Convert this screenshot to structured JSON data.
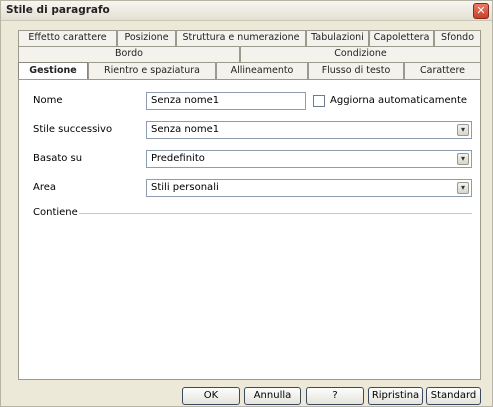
{
  "window": {
    "title": "Stile di paragrafo"
  },
  "tabs": {
    "row1": [
      "Effetto carattere",
      "Posizione",
      "Struttura e numerazione",
      "Tabulazioni",
      "Capolettera",
      "Sfondo"
    ],
    "row2": [
      "Bordo",
      "Condizione"
    ],
    "row3": [
      "Gestione",
      "Rientro e spaziatura",
      "Allineamento",
      "Flusso di testo",
      "Carattere"
    ],
    "active": "Gestione"
  },
  "form": {
    "nome_label": "Nome",
    "nome_value": "Senza nome1",
    "auto_update_label": "Aggiorna automaticamente",
    "auto_update_checked": false,
    "next_style_label": "Stile successivo",
    "next_style_value": "Senza nome1",
    "based_on_label": "Basato su",
    "based_on_value": "Predefinito",
    "area_label": "Area",
    "area_value": "Stili personali",
    "contains_label": "Contiene"
  },
  "buttons": {
    "ok": "OK",
    "cancel": "Annulla",
    "help": "?",
    "reset": "Ripristina",
    "standard": "Standard"
  },
  "icons": {
    "dropdown": "▾",
    "close": "✕"
  }
}
